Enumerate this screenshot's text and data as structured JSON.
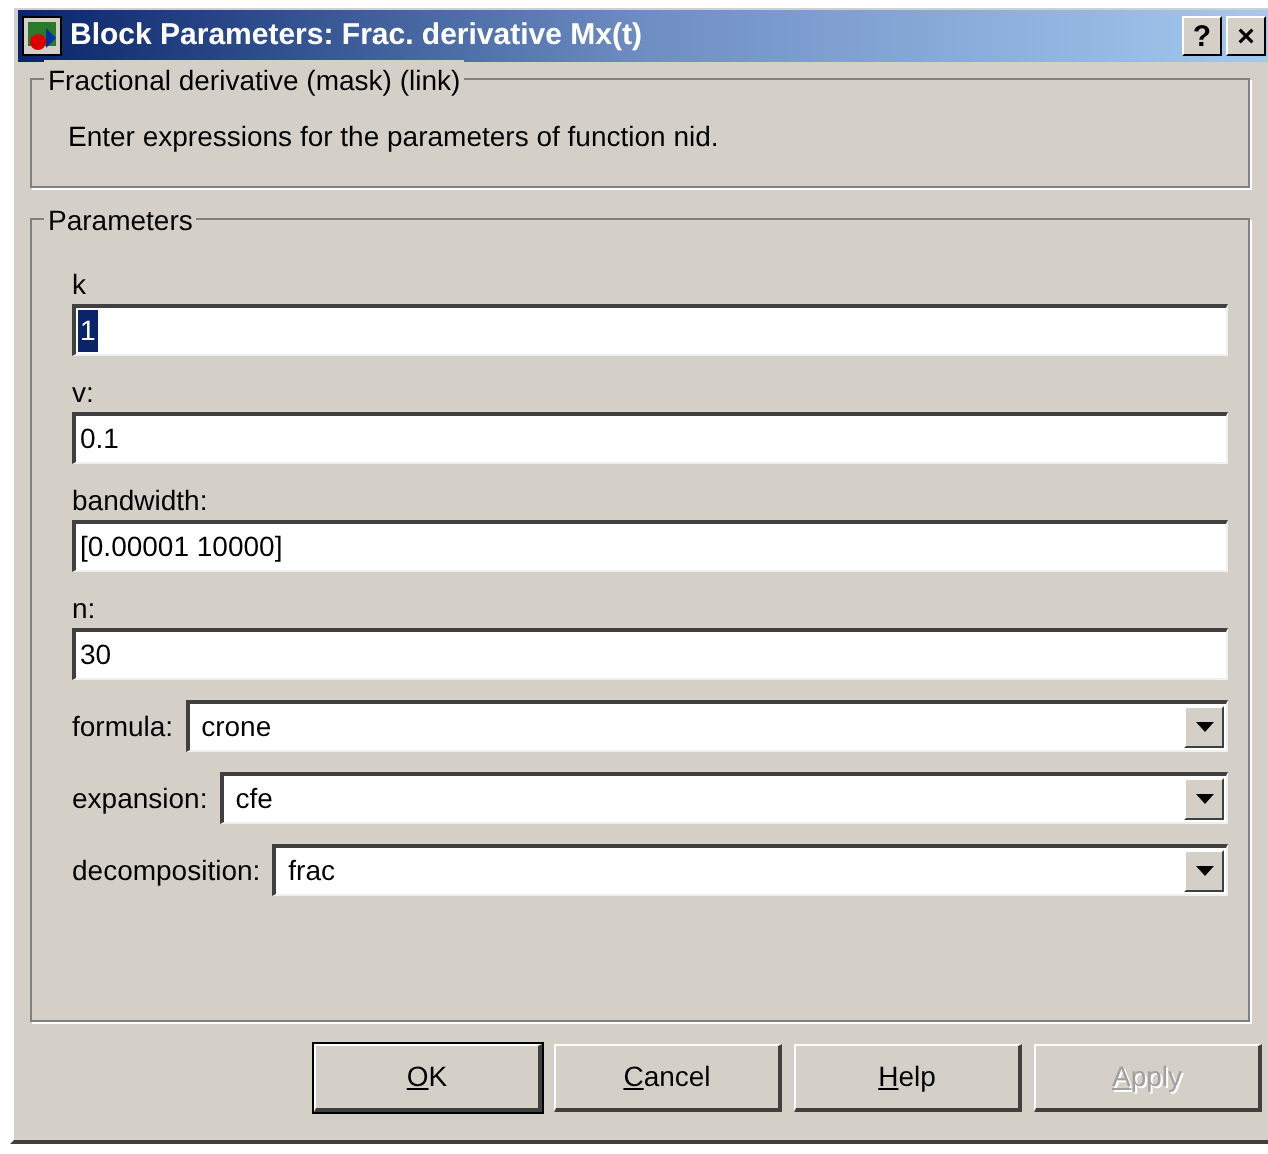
{
  "window": {
    "title": "Block Parameters: Frac. derivative Mx(t)",
    "title_buttons": [
      "?",
      "×"
    ]
  },
  "description_group": {
    "title": "Fractional derivative (mask) (link)",
    "text": "Enter expressions for the parameters of function nid."
  },
  "parameters_group": {
    "title": "Parameters",
    "fields": [
      {
        "kind": "text",
        "label": "k",
        "value": "1",
        "selected": true
      },
      {
        "kind": "text",
        "label": "v:",
        "value": "0.1",
        "selected": false
      },
      {
        "kind": "text",
        "label": "bandwidth:",
        "value": "[0.00001 10000]",
        "selected": false
      },
      {
        "kind": "text",
        "label": "n:",
        "value": "30",
        "selected": false
      },
      {
        "kind": "dropdown",
        "label": "formula:",
        "value": "crone",
        "selected": false
      },
      {
        "kind": "dropdown",
        "label": "expansion:",
        "value": "cfe",
        "selected": false
      },
      {
        "kind": "dropdown",
        "label": "decomposition:",
        "value": "frac",
        "selected": false
      }
    ]
  },
  "buttons": [
    {
      "label": "OK",
      "disabled": false,
      "default": true
    },
    {
      "label": "Cancel",
      "disabled": false,
      "default": false
    },
    {
      "label": "Help",
      "disabled": false,
      "default": false
    },
    {
      "label": "Apply",
      "disabled": true,
      "default": false
    }
  ]
}
